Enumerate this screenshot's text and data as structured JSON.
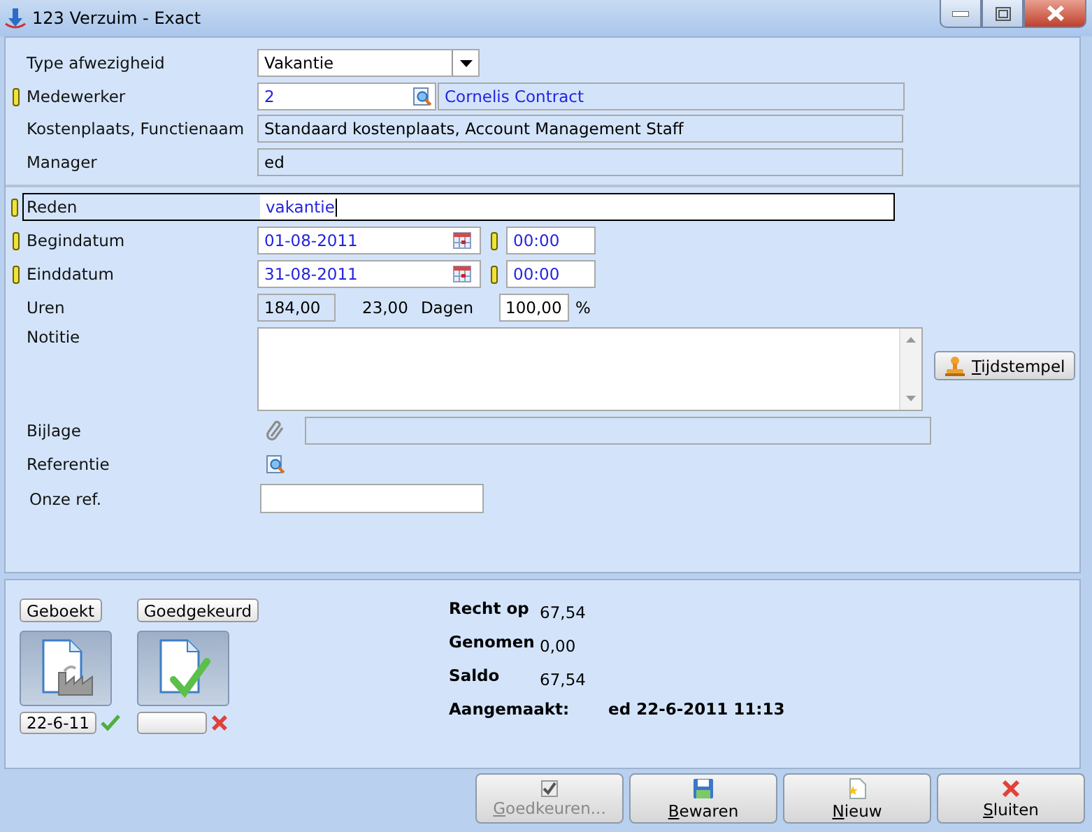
{
  "window": {
    "title": "123 Verzuim - Exact"
  },
  "form": {
    "type": {
      "label": "Type afwezigheid",
      "value": "Vakantie"
    },
    "medewerker": {
      "label": "Medewerker",
      "required": true,
      "value": "2",
      "name": "Cornelis Contract"
    },
    "kostenplaats": {
      "label": "Kostenplaats, Functienaam",
      "value": "Standaard kostenplaats, Account Management Staff"
    },
    "manager": {
      "label": "Manager",
      "value": "ed"
    },
    "reden": {
      "label": "Reden",
      "required": true,
      "focused": true,
      "value": "vakantie"
    },
    "begindatum": {
      "label": "Begindatum",
      "required": true,
      "date": "01-08-2011",
      "time_required": true,
      "time": "00:00"
    },
    "einddatum": {
      "label": "Einddatum",
      "required": true,
      "date": "31-08-2011",
      "time_required": true,
      "time": "00:00"
    },
    "uren": {
      "label": "Uren",
      "hours": "184,00",
      "days": "23,00",
      "days_label": "Dagen",
      "percent": "100,00",
      "percent_sign": "%"
    },
    "notitie": {
      "label": "Notitie"
    },
    "tijdstempel": {
      "key": "T",
      "rest": "ijdstempel"
    },
    "bijlage": {
      "label": "Bijlage"
    },
    "referentie": {
      "label": "Referentie"
    },
    "onze_ref": {
      "label": "Onze ref."
    }
  },
  "status": {
    "stages": [
      {
        "label": "Geboekt",
        "kind": "booked",
        "date": "22-6-11",
        "done": true
      },
      {
        "label": "Goedgekeurd",
        "kind": "approved",
        "done": false
      }
    ],
    "summary": [
      {
        "label": "Recht op",
        "value": "67,54"
      },
      {
        "label": "Genomen",
        "value": "0,00"
      },
      {
        "label": "Saldo",
        "value": "67,54"
      }
    ],
    "created": {
      "label": "Aangemaakt:",
      "value": "ed 22-6-2011 11:13"
    }
  },
  "buttons": [
    {
      "key": "G",
      "rest": "oedkeuren...",
      "kind": "approve",
      "disabled": true
    },
    {
      "key": "B",
      "rest": "ewaren",
      "kind": "save",
      "disabled": false
    },
    {
      "key": "N",
      "rest": "ieuw",
      "kind": "new",
      "disabled": false
    },
    {
      "key": "S",
      "rest": "luiten",
      "kind": "close",
      "disabled": false
    }
  ]
}
